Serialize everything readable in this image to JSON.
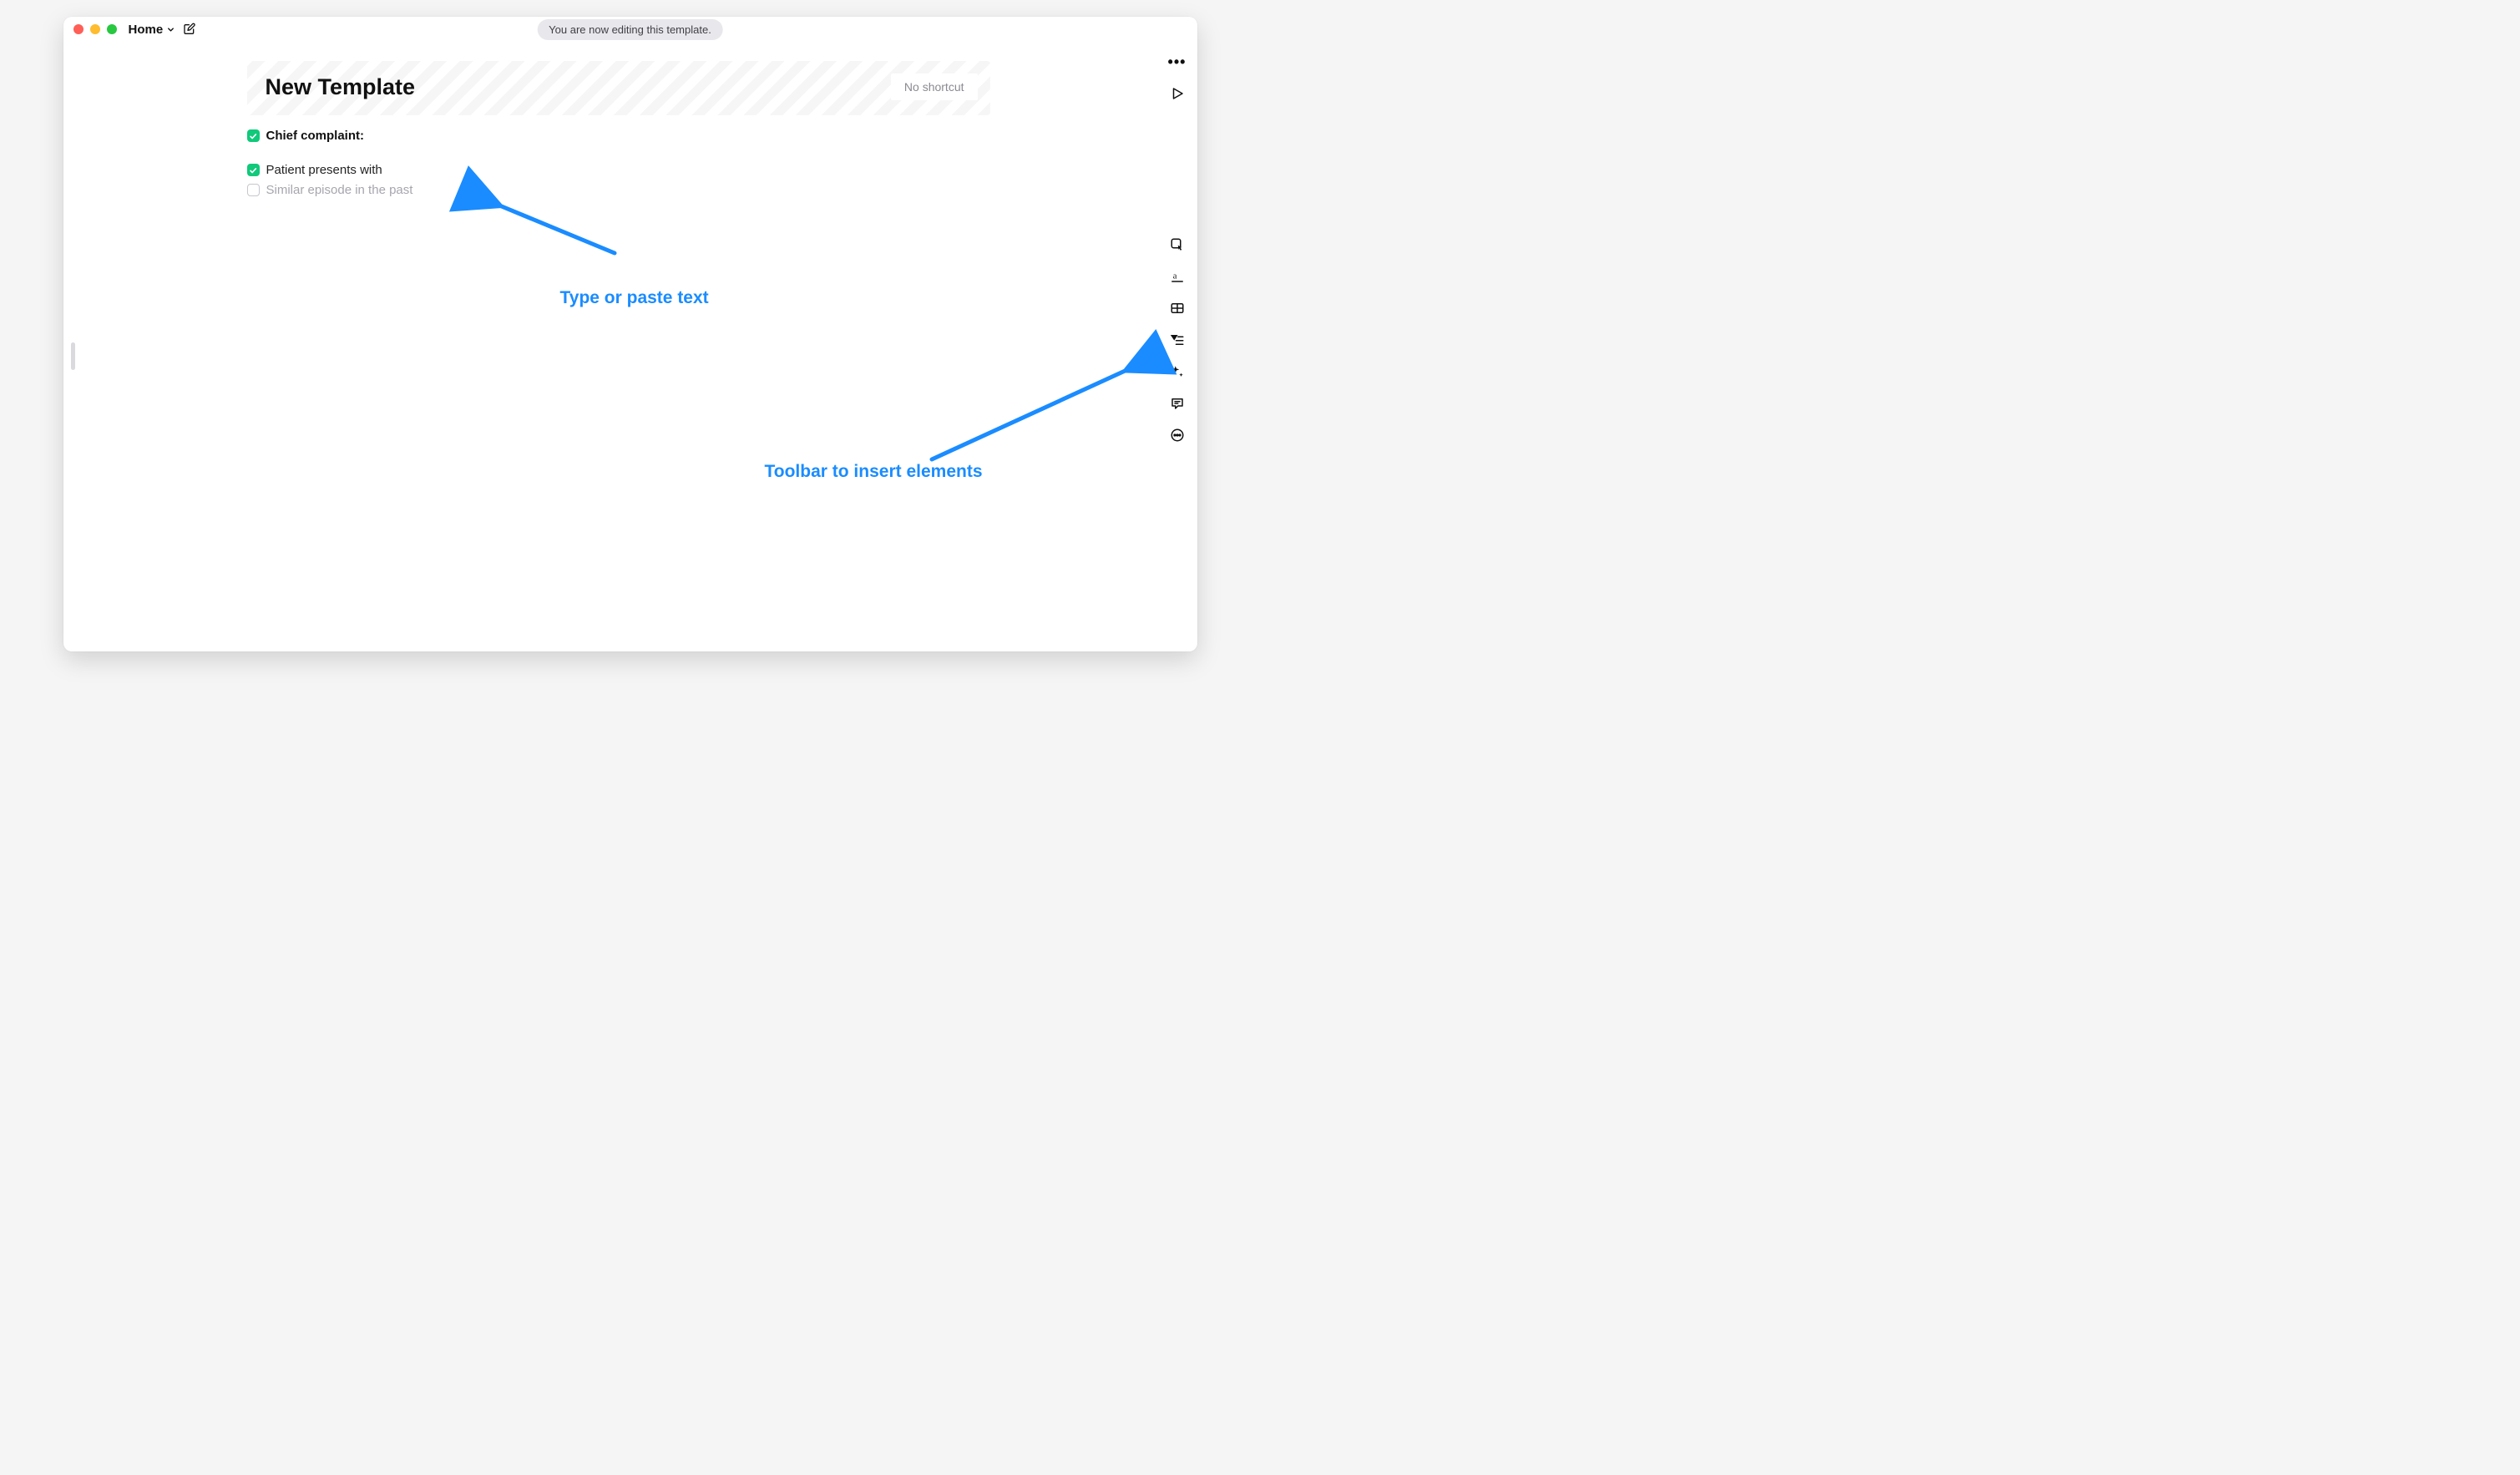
{
  "titlebar": {
    "nav_label": "Home",
    "banner": "You are now editing this template."
  },
  "header": {
    "title": "New Template",
    "shortcut_placeholder": "No shortcut"
  },
  "content": {
    "section_label": "Chief complaint",
    "section_suffix": ":",
    "items": [
      {
        "text": "Patient presents with",
        "checked": true
      },
      {
        "text": "Similar episode in the past",
        "checked": false
      }
    ]
  },
  "rail": {
    "icons": [
      "more",
      "play",
      "cursor",
      "text-style",
      "table",
      "filter",
      "ai",
      "comment",
      "more-circle"
    ]
  },
  "annotations": {
    "type_text": "Type or paste text",
    "toolbar_text": "Toolbar to insert elements"
  }
}
